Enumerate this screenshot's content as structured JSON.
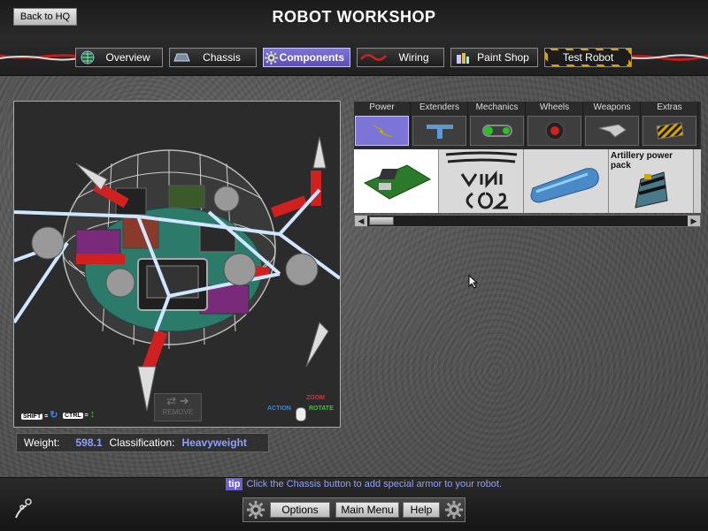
{
  "header": {
    "title": "ROBOT WORKSHOP",
    "back_label": "Back to HQ"
  },
  "nav": {
    "tabs": [
      {
        "label": "Overview",
        "icon": "globe-icon"
      },
      {
        "label": "Chassis",
        "icon": "chassis-icon"
      },
      {
        "label": "Components",
        "icon": "gear-icon",
        "active": true
      },
      {
        "label": "Wiring",
        "icon": "wire-icon"
      },
      {
        "label": "Paint Shop",
        "icon": "paint-cans-icon"
      },
      {
        "label": "Test Robot",
        "icon": ""
      }
    ]
  },
  "viewport": {
    "remove_label": "REMOVE",
    "shift_key": "SHIFT",
    "ctrl_key": "CTRL",
    "action_label": "ACTION",
    "zoom_label": "ZOOM",
    "rotate_label": "ROTATE",
    "eq": "="
  },
  "stats": {
    "weight_label": "Weight:",
    "weight_value": "598.1",
    "class_label": "Classification:",
    "class_value": "Heavyweight"
  },
  "catalog": {
    "categories": [
      {
        "label": "Power",
        "active": true
      },
      {
        "label": "Extenders"
      },
      {
        "label": "Mechanics"
      },
      {
        "label": "Wheels"
      },
      {
        "label": "Weapons"
      },
      {
        "label": "Extras"
      }
    ],
    "items": [
      {
        "name": ""
      },
      {
        "name": ""
      },
      {
        "name": ""
      },
      {
        "name": "Artillery power pack"
      }
    ]
  },
  "tip": {
    "badge": "tip",
    "text": "Click the Chassis button to add special armor to your robot."
  },
  "bottom": {
    "options_label": "Options",
    "main_menu_label": "Main Menu",
    "help_label": "Help"
  },
  "colors": {
    "accent": "#6d5fd0",
    "value_text": "#8fa0ff"
  }
}
